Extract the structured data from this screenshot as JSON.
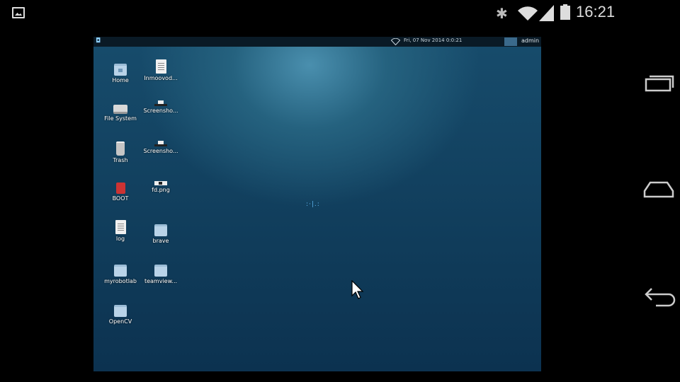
{
  "status_bar": {
    "left_icon": "image-notification-icon",
    "icons": [
      "bluetooth-icon",
      "wifi-icon",
      "signal-icon",
      "battery-icon"
    ],
    "time": "16:21"
  },
  "nav_bar": {
    "buttons": [
      "recent-apps-icon",
      "home-icon",
      "back-icon"
    ]
  },
  "remote_desktop": {
    "taskbar": {
      "clock": "Fri, 07 Nov 2014 0:0:21",
      "user": "admin"
    },
    "icons": [
      {
        "label": "Home",
        "icon": "home-folder-icon"
      },
      {
        "label": "File System",
        "icon": "drive-icon"
      },
      {
        "label": "Trash",
        "icon": "trash-icon"
      },
      {
        "label": "BOOT",
        "icon": "sd-card-icon"
      },
      {
        "label": "log",
        "icon": "text-file-icon"
      },
      {
        "label": "myrobotlab",
        "icon": "folder-icon"
      },
      {
        "label": "OpenCV",
        "icon": "folder-icon"
      },
      {
        "label": "Inmoovod...",
        "icon": "text-file-icon"
      },
      {
        "label": "Screensho...",
        "icon": "image-file-icon"
      },
      {
        "label": "Screensho...",
        "icon": "image-file-icon"
      },
      {
        "label": "fd.png",
        "icon": "image-file-icon"
      },
      {
        "label": "brave",
        "icon": "folder-icon"
      },
      {
        "label": "teamview...",
        "icon": "folder-icon"
      }
    ],
    "loading_text": ":·|.:"
  }
}
